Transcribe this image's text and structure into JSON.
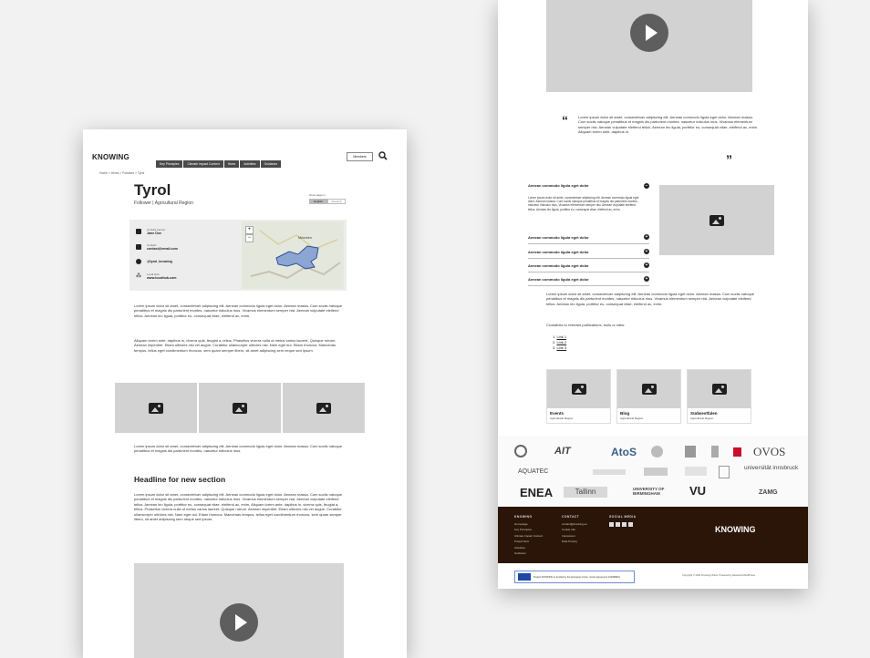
{
  "left": {
    "logo": "KNOWING",
    "nav": [
      "Key Principles",
      "Climate Impact Context",
      "Hives",
      "Activities",
      "Guidance"
    ],
    "register_label": "Members",
    "breadcrumb": [
      "Home",
      "Hives",
      "Follower",
      "Tyrol"
    ],
    "title": "Tyrol",
    "subtitle": "Follower | Agricultural Region",
    "lang_label": "show page in",
    "lang_options": [
      "English",
      "Deutsch"
    ],
    "contacts": [
      {
        "icon": "person-icon",
        "label": "Contact person",
        "value": "Jane Doe"
      },
      {
        "icon": "mail-icon",
        "label": "Contact",
        "value": "contact@email.com"
      },
      {
        "icon": "facebook-icon",
        "label": "",
        "value": "@tyrol_knowing"
      },
      {
        "icon": "network-icon",
        "label": "Local Hub",
        "value": "www.localhub.com"
      }
    ],
    "map": {
      "city": "München",
      "zoom_in": "+",
      "zoom_out": "−"
    },
    "para1": "Lorem ipsum dolor sit amet, consectetuer adipiscing elit. Aenean commodo ligula eget dolor. Aenean massa. Cum sociis natoque penatibus et magnis dis parturient montes, nascetur ridiculus mus. Vivamus elementum semper nisi. Aenean vulputate eleifend tellus. Aenean leo ligula, porttitor eu, consequat vitae, eleifend ac, enim.",
    "para2": "Aliquam lorem ante, dapibus in, viverra quis, feugiat a, tellus. Phasellus viverra nulla ut metus varius laoreet. Quisque rutrum. Aenean imperdiet. Etiam ultricies nisi vel augue. Curabitur ullamcorper ultricies nisi. Nam eget dui. Etiam rhoncus. Maecenas tempus, tellus eget condimentum rhoncus, sem quam semper libero, sit amet adipiscing sem neque sed ipsum.",
    "para3": "Lorem ipsum dolor sit amet, consectetuer adipiscing elit. Aenean commodo ligula eget dolor. Aenean massa. Cum sociis natoque penatibus et magnis dis parturient montes, nascetur ridiculus mus.",
    "section_headline": "Headline for new section",
    "para4": "Lorem ipsum dolor sit amet, consectetuer adipiscing elit. Aenean commodo ligula eget dolor. Aenean massa. Cum sociis natoque penatibus et magnis dis parturient montes, nascetur ridiculus mus. Vivamus elementum semper nisi. Aenean vulputate eleifend tellus. Aenean leo ligula, porttitor eu, consequat vitae, eleifend ac, enim. Aliquam lorem ante, dapibus in, viverra quis, feugiat a, tellus. Phasellus viverra nulla ut metus varius laoreet. Quisque rutrum. Aenean imperdiet. Etiam ultricies nisi vel augue. Curabitur ullamcorper ultricies nisi. Nam eget dui. Etiam rhoncus. Maecenas tempus, tellus eget condimentum rhoncus, sem quam semper libero, sit amet adipiscing sem neque sed ipsum."
  },
  "right": {
    "quote": "Lorem ipsum dolor sit amet, consectetuer adipiscing elit. Aenean commodo ligula eget dolor. Aenean massa. Cum sociis natoque penatibus et magnis dis parturient montes, nascetur ridiculus mus. Vivamus elementum semper nisi. Aenean vulputate eleifend tellus. Aenean leo ligula, porttitor eu, consequat vitae, eleifend ac, enim. Aliquam lorem ante, dapibus in.",
    "accordion": [
      {
        "title": "Aenean commodo ligula eget dolor",
        "open": true,
        "body": "Lorem ipsum dolor sit amet, consectetuer adipiscing elit. Aenean commodo ligula eget dolor. Aenean massa. Cum sociis natoque penatibus et magnis dis parturient montes, nascetur ridiculus mus. Vivamus elementum semper nisi. Aenean vulputate eleifend tellus. Aenean leo ligula, porttitor eu, consequat vitae, eleifend ac, enim."
      },
      {
        "title": "Aenean commodo ligula eget dolor",
        "open": false
      },
      {
        "title": "Aenean commodo ligula eget dolor",
        "open": false
      },
      {
        "title": "Aenean commodo ligula eget dolor",
        "open": false
      },
      {
        "title": "Aenean commodo ligula eget dolor",
        "open": false
      }
    ],
    "para": "Lorem ipsum dolor sit amet, consectetuer adipiscing elit. Aenean commodo ligula eget dolor. Aenean massa. Cum sociis natoque penatibus et magnis dis parturient montes, nascetur ridiculus mus. Vivamus elementum semper nisi. Aenean vulputate eleifend tellus. Aenean leo ligula, porttitor eu, consequat vitae, eleifend ac, enim.",
    "crosslinks_label": "Crosslinks to relevant publications, tools or sites:",
    "links": [
      "Link 1",
      "Link 2",
      "Link 3"
    ],
    "cards": [
      {
        "title": "Events",
        "sub": "Agricultural Region"
      },
      {
        "title": "Blog",
        "sub": "Agricultural Region"
      },
      {
        "title": "Südwestfalen",
        "sub": "Agricultural Region"
      }
    ],
    "partners": [
      "AIT",
      "AtoS",
      "OVOS",
      "AQUATEC",
      "universität innsbruck",
      "ENEA",
      "Tallinn",
      "UNIVERSITY OF BIRMINGHAM",
      "VU",
      "ZAMG"
    ],
    "footer": {
      "cols": [
        {
          "head": "KNOWING",
          "items": [
            "Homepage",
            "Key Principles",
            "Climate Impact Context",
            "Project Hive",
            "Activities",
            "Guidance"
          ]
        },
        {
          "head": "CONTACT",
          "items": [
            "contact@knowing.eu",
            "Cookie info",
            "Impressum",
            "Data Privacy"
          ]
        },
        {
          "head": "SOCIAL MEDIA",
          "items": []
        }
      ],
      "logo": "KNOWING",
      "eu_note": "Project KNOWING is funded by the European Union. Grant Agreement 101056841",
      "copyright": "Copyright © 2024 Knowing Online. Powered by Advanced WordPress"
    }
  },
  "colors": {
    "footer_bg": "#2b1509",
    "placeholder": "#d2d2d2",
    "accent_red": "#c8102e"
  }
}
